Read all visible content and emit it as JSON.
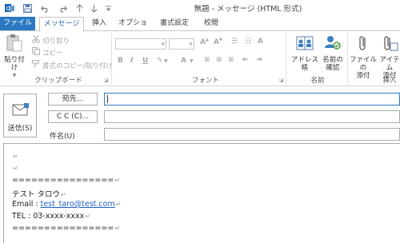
{
  "window": {
    "title": "無題 - メッセージ (HTML 形式)"
  },
  "quick_access": {
    "icons": [
      "save-icon",
      "undo-icon",
      "redo-icon",
      "up-arrow-icon",
      "down-arrow-icon",
      "customize-icon"
    ]
  },
  "tabs": [
    {
      "label": "ファイル"
    },
    {
      "label": "メッセージ"
    },
    {
      "label": "挿入"
    },
    {
      "label": "オプション"
    },
    {
      "label": "書式設定"
    },
    {
      "label": "校閲"
    }
  ],
  "ribbon": {
    "clipboard": {
      "paste_label": "貼り付け",
      "cut_label": "切り取り",
      "copy_label": "コピー",
      "format_painter_label": "書式のコピー/貼り付け",
      "group_label": "クリップボード"
    },
    "font": {
      "group_label": "フォント"
    },
    "names": {
      "address_book_label": "アドレス帳",
      "check_names_line1": "名前の",
      "check_names_line2": "確認",
      "group_label": "名前"
    },
    "include": {
      "attach_file_line1": "ファイルの",
      "attach_file_line2": "添付",
      "attach_item_line1": "アイテム",
      "attach_item_line2": "添付",
      "group_label": "挿入"
    }
  },
  "compose": {
    "send_label": "送信(S)",
    "to_button": "宛先...",
    "cc_button": "C C (C)...",
    "subject_label": "件名(U)",
    "to_value": "",
    "cc_value": "",
    "subject_value": ""
  },
  "body": {
    "separator": "================",
    "name": "テスト タロウ",
    "email_label": "Email : ",
    "email": "test_taro@test.com",
    "tel": "TEL : 03-xxxx-xxxx"
  }
}
